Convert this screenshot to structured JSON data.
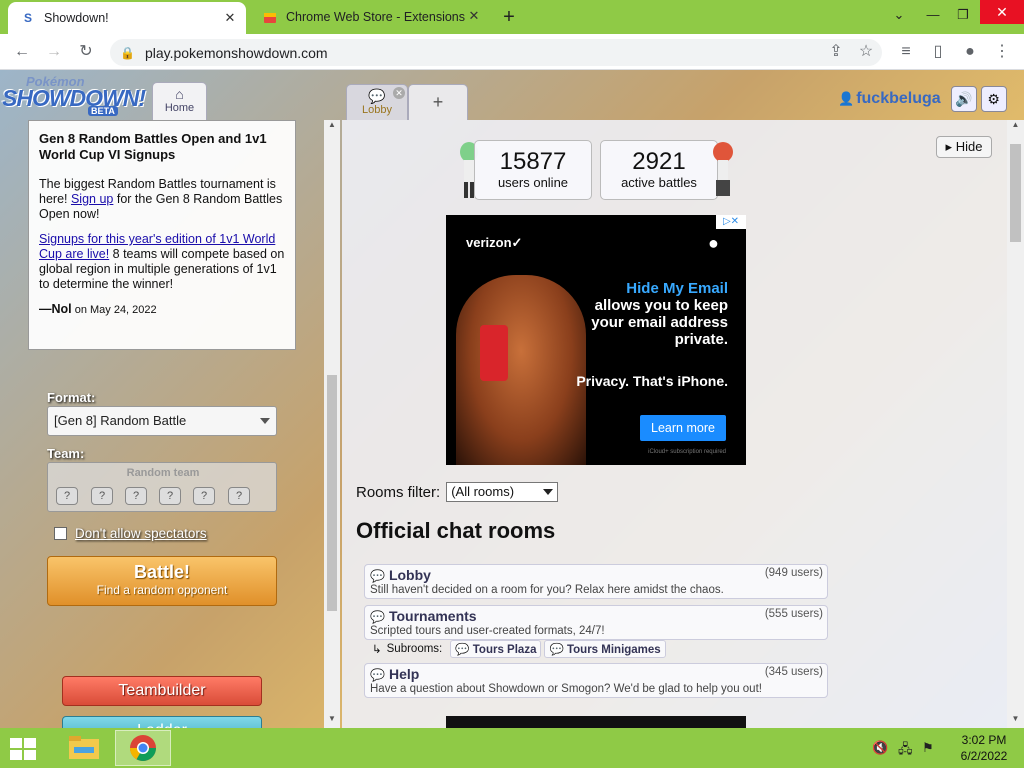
{
  "browser": {
    "tabs": [
      {
        "title": "Showdown!",
        "favicon": "showdown-favicon",
        "active": true
      },
      {
        "title": "Chrome Web Store - Extensions",
        "favicon": "chrome-store-favicon",
        "active": false
      }
    ],
    "url": "play.pokemonshowdown.com"
  },
  "header": {
    "logo": {
      "line1": "Pokémon",
      "line2": "SHOWDOWN!",
      "badge": "BETA"
    },
    "tabs": {
      "home": "Home",
      "lobby": "Lobby",
      "plus": "+"
    },
    "username": "fuckbeluga"
  },
  "news": {
    "title": "Gen 8 Random Battles Open and 1v1 World Cup VI Signups",
    "p1_before": "The biggest Random Battles tournament is here! ",
    "p1_link": "Sign up",
    "p1_after": " for the Gen 8 Random Battles Open now!",
    "p2_link": "Signups for this year's edition of 1v1 World Cup are live!",
    "p2_after": " 8 teams will compete based on global region in multiple generations of 1v1 to determine the winner!",
    "author": "—Nol",
    "date": " on May 24, 2022"
  },
  "form": {
    "format_label": "Format:",
    "format_value": "[Gen 8] Random Battle",
    "team_label": "Team:",
    "team_value": "Random team",
    "spectators_label": "Don't allow spectators",
    "battle_title": "Battle!",
    "battle_sub": "Find a random opponent",
    "teambuilder": "Teambuilder",
    "ladder": "Ladder"
  },
  "stats": {
    "users_num": "15877",
    "users_label": "users online",
    "battles_num": "2921",
    "battles_label": "active battles"
  },
  "hide": "Hide",
  "ad": {
    "brand": "verizon✓",
    "headline": "Hide My Email",
    "body": "allows you to keep your email address private.",
    "tagline": "Privacy. That's iPhone.",
    "cta": "Learn more",
    "fine": "iCloud+ subscription required"
  },
  "rooms": {
    "filter_label": "Rooms filter:",
    "filter_value": "(All rooms)",
    "heading": "Official chat rooms",
    "list": [
      {
        "name": "Lobby",
        "users": "(949 users)",
        "desc": "Still haven't decided on a room for you? Relax here amidst the chaos."
      },
      {
        "name": "Tournaments",
        "users": "(555 users)",
        "desc": "Scripted tours and user-created formats, 24/7!"
      },
      {
        "name": "Help",
        "users": "(345 users)",
        "desc": "Have a question about Showdown or Smogon? We'd be glad to help you out!"
      }
    ],
    "subrooms_label": "Subrooms:",
    "subrooms": [
      "Tours Plaza",
      "Tours Minigames"
    ]
  },
  "taskbar": {
    "time": "3:02 PM",
    "date": "6/2/2022"
  }
}
